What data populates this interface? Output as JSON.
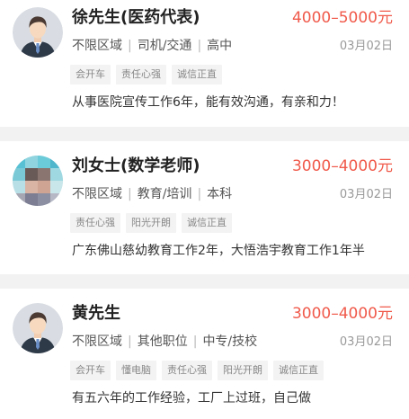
{
  "colors": {
    "salary": "#f05a4b",
    "tag_bg": "#f3f3f3",
    "divider_bg": "#f2f2f2"
  },
  "candidates": [
    {
      "name": "徐先生(医药代表)",
      "salary": "4000–5000元",
      "meta": [
        "不限区域",
        "司机/交通",
        "高中"
      ],
      "date": "03月02日",
      "tags": [
        "会开车",
        "责任心强",
        "诚信正直"
      ],
      "description": "从事医院宣传工作6年，能有效沟通，有亲和力！",
      "avatar_icon": "male-avatar-icon"
    },
    {
      "name": "刘女士(数学老师)",
      "salary": "3000–4000元",
      "meta": [
        "不限区域",
        "教育/培训",
        "本科"
      ],
      "date": "03月02日",
      "tags": [
        "责任心强",
        "阳光开朗",
        "诚信正直"
      ],
      "description": "广东佛山慈幼教育工作2年，大悟浩宇教育工作1年半",
      "avatar_icon": "blurred-photo-avatar"
    },
    {
      "name": "黄先生",
      "salary": "3000–4000元",
      "meta": [
        "不限区域",
        "其他职位",
        "中专/技校"
      ],
      "date": "03月02日",
      "tags": [
        "会开车",
        "懂电脑",
        "责任心强",
        "阳光开朗",
        "诚信正直"
      ],
      "description": "有五六年的工作经验，工厂上过班，自己做",
      "avatar_icon": "male-avatar-icon"
    }
  ]
}
